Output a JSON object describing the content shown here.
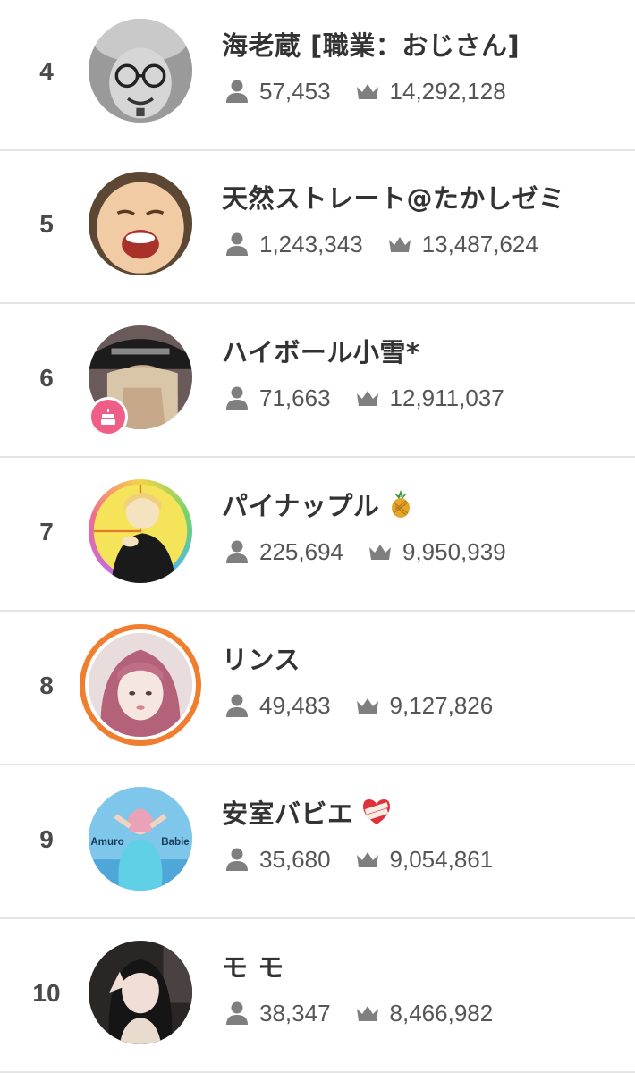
{
  "icons": {
    "followers": "person-icon",
    "points": "crown-icon",
    "birthday": "cake-icon",
    "pineapple": "pineapple-emoji",
    "heart": "bandaged-heart-emoji"
  },
  "colors": {
    "rank_text": "#4a4a4a",
    "name_text": "#333333",
    "stat_text": "#555555",
    "stat_icon": "#7f7f7f",
    "live_ring": "#f07e2e",
    "birthday_badge": "#ef5e86",
    "divider": "#e4e4e4"
  },
  "ranking": [
    {
      "rank": "4",
      "name": "海老蔵 [職業：おじさん]",
      "followers": "57,453",
      "points": "14,292,128"
    },
    {
      "rank": "5",
      "name": "天然ストレート@たかしゼミ",
      "followers": "1,243,343",
      "points": "13,487,624"
    },
    {
      "rank": "6",
      "name": "ハイボール小雪*",
      "followers": "71,663",
      "points": "12,911,037",
      "badge": "birthday"
    },
    {
      "rank": "7",
      "name": "パイナップル",
      "name_emoji": "🍍",
      "followers": "225,694",
      "points": "9,950,939"
    },
    {
      "rank": "8",
      "name": "リンス",
      "followers": "49,483",
      "points": "9,127,826",
      "live_ring": true
    },
    {
      "rank": "9",
      "name": "安室バビエ",
      "name_emoji": "❤️‍🩹",
      "followers": "35,680",
      "points": "9,054,861",
      "avatar_text": [
        "Amuro",
        "Babie"
      ]
    },
    {
      "rank": "10",
      "name": "モ モ",
      "followers": "38,347",
      "points": "8,466,982"
    }
  ]
}
